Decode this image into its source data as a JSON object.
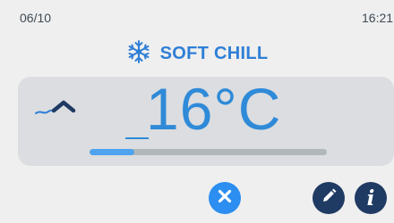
{
  "status_bar": {
    "date": "06/10",
    "time": "16:21"
  },
  "mode": {
    "label": "SOFT CHILL",
    "icon": "snowflake-icon",
    "color": "#2f7fd6"
  },
  "reading": {
    "temperature": "16°C",
    "progress": 0.19
  },
  "buttons": {
    "cancel_icon": "close-icon",
    "edit_icon": "pencil-icon",
    "info_icon": "info-icon",
    "info_glyph": "i"
  },
  "colors": {
    "background": "#efefef",
    "panel": "#dbdde0",
    "accent": "#2f8ad8",
    "cancel_button": "#2b8ef0",
    "dark_button": "#1f3a63"
  }
}
